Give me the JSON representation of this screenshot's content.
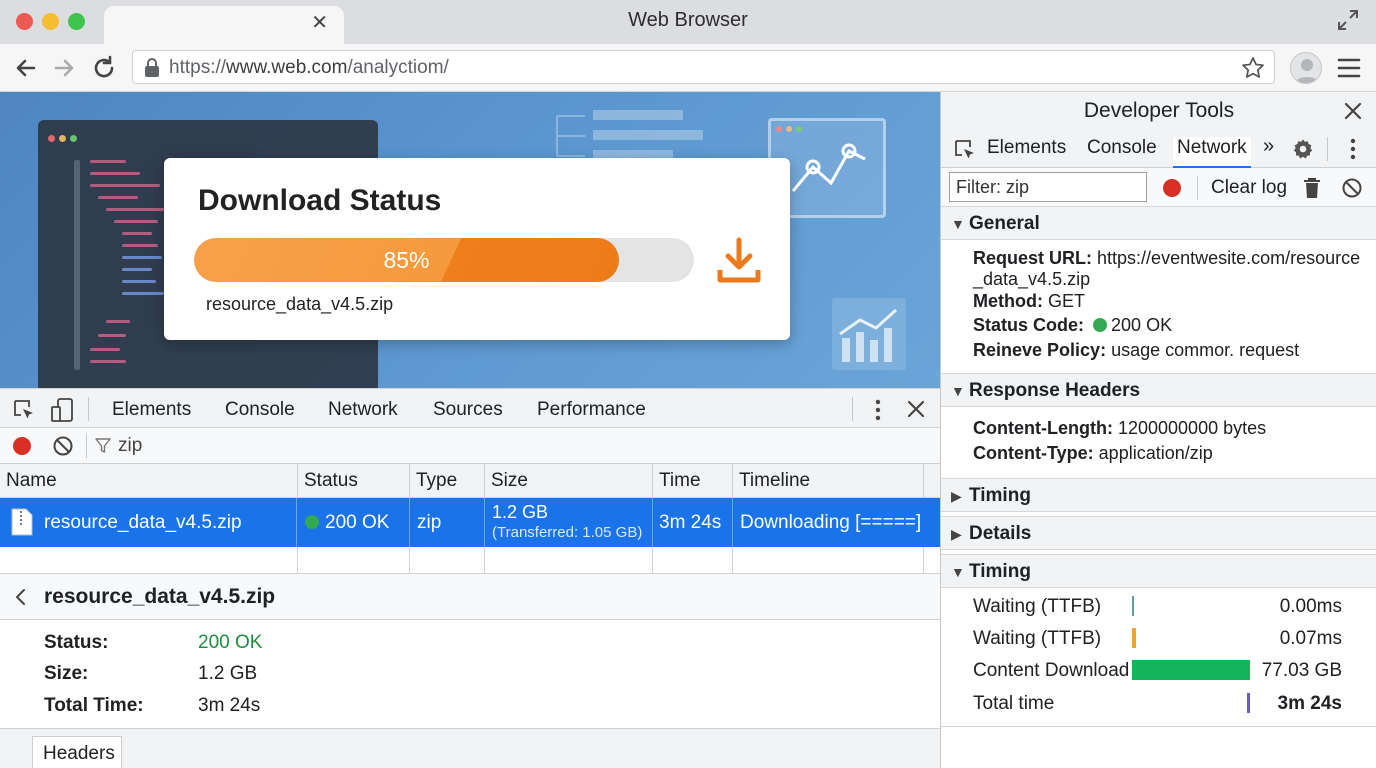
{
  "window": {
    "title": "Web Browser"
  },
  "toolbar": {
    "url_prefix": "https://",
    "url_host": "www.web.com",
    "url_path": "/analyctiom/"
  },
  "page": {
    "download_card": {
      "title": "Download Status",
      "progress_percent": 85,
      "progress_label": "85%",
      "file_name": "resource_data_v4.5.zip"
    }
  },
  "bottom_devtools": {
    "tabs": [
      "Elements",
      "Console",
      "Network",
      "Sources",
      "Performance"
    ],
    "active_tab": "Network",
    "filter_text": "zip",
    "table": {
      "columns": [
        "Name",
        "Status",
        "Type",
        "Size",
        "Time",
        "Timeline"
      ],
      "rows": [
        {
          "name": "resource_data_v4.5.zip",
          "status": "200 OK",
          "type": "zip",
          "size": "1.2 GB",
          "transferred": "(Transferred: 1.05 GB)",
          "time": "3m 24s",
          "timeline": "Downloading [=====]"
        }
      ]
    },
    "detail": {
      "title": "resource_data_v4.5.zip",
      "status_label": "Status:",
      "status_value": "200 OK",
      "size_label": "Size:",
      "size_value": "1.2 GB",
      "total_label": "Total Time:",
      "total_value": "3m 24s",
      "tab": "Headers"
    }
  },
  "right_devtools": {
    "title": "Developer Tools",
    "tabs": [
      "Elements",
      "Console",
      "Network"
    ],
    "active_tab": "Network",
    "filter_value": "Filter: zip",
    "clear_log": "Clear log",
    "general": {
      "heading": "General",
      "request_url_label": "Request URL:",
      "request_url": "https://eventwesite.com/resource_data_v4.5.zip",
      "method_label": "Method:",
      "method": "GET",
      "status_label": "Status Code:",
      "status": "200 OK",
      "policy_label": "Reineve Policy:",
      "policy": "usage commor. request"
    },
    "response_headers": {
      "heading": "Response Headers",
      "content_length_label": "Content-Length:",
      "content_length": "1200000000 bytes",
      "content_type_label": "Content-Type:",
      "content_type": "application/zip"
    },
    "timing_collapsed": "Timing",
    "details_collapsed": "Details",
    "timing": {
      "heading": "Timing",
      "rows": [
        {
          "label": "Waiting (TTFB)",
          "value": "0.00ms",
          "color": "#5aa0a6"
        },
        {
          "label": "Waiting (TTFB)",
          "value": "0.07ms",
          "color": "#f0a33a"
        },
        {
          "label": "Content Download",
          "value": "77.03 GB",
          "color": "#14b45a"
        },
        {
          "label": "Total time",
          "value": "3m 24s",
          "color": "#6a5bbf"
        }
      ]
    }
  },
  "colors": {
    "accent": "#1a73e8",
    "progress": "#f39234",
    "ok_green": "#34a853",
    "record_red": "#d93025"
  }
}
